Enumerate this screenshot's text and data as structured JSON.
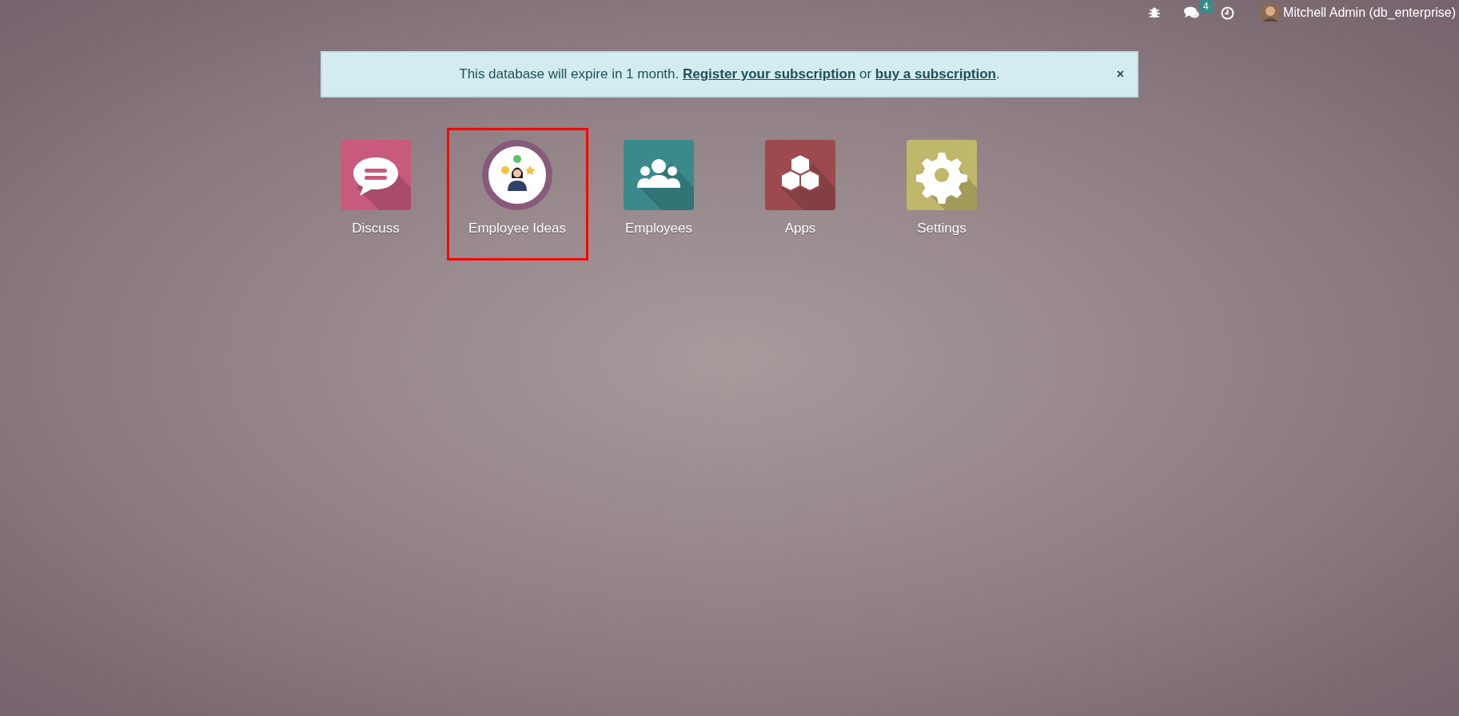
{
  "topbar": {
    "chat_badge": "4",
    "user": "Mitchell Admin (db_enterprise)"
  },
  "banner": {
    "parts": [
      {
        "kind": "text",
        "text": "This database will expire in 1 month. "
      },
      {
        "kind": "link",
        "text": "Register your subscription"
      },
      {
        "kind": "text",
        "text": " or "
      },
      {
        "kind": "link",
        "text": "buy a subscription"
      },
      {
        "kind": "text",
        "text": "."
      }
    ],
    "close": "×"
  },
  "apps": [
    {
      "label": "Discuss",
      "kind": "discuss",
      "color": "#c85a7c",
      "highlighted": false
    },
    {
      "label": "Employee Ideas",
      "kind": "ideas",
      "color": "#875a7b",
      "highlighted": true
    },
    {
      "label": "Employees",
      "kind": "employees",
      "color": "#3a8a8c",
      "highlighted": false
    },
    {
      "label": "Apps",
      "kind": "apps",
      "color": "#9c4a4e",
      "highlighted": false
    },
    {
      "label": "Settings",
      "kind": "settings",
      "color": "#bfb86a",
      "highlighted": false
    }
  ]
}
